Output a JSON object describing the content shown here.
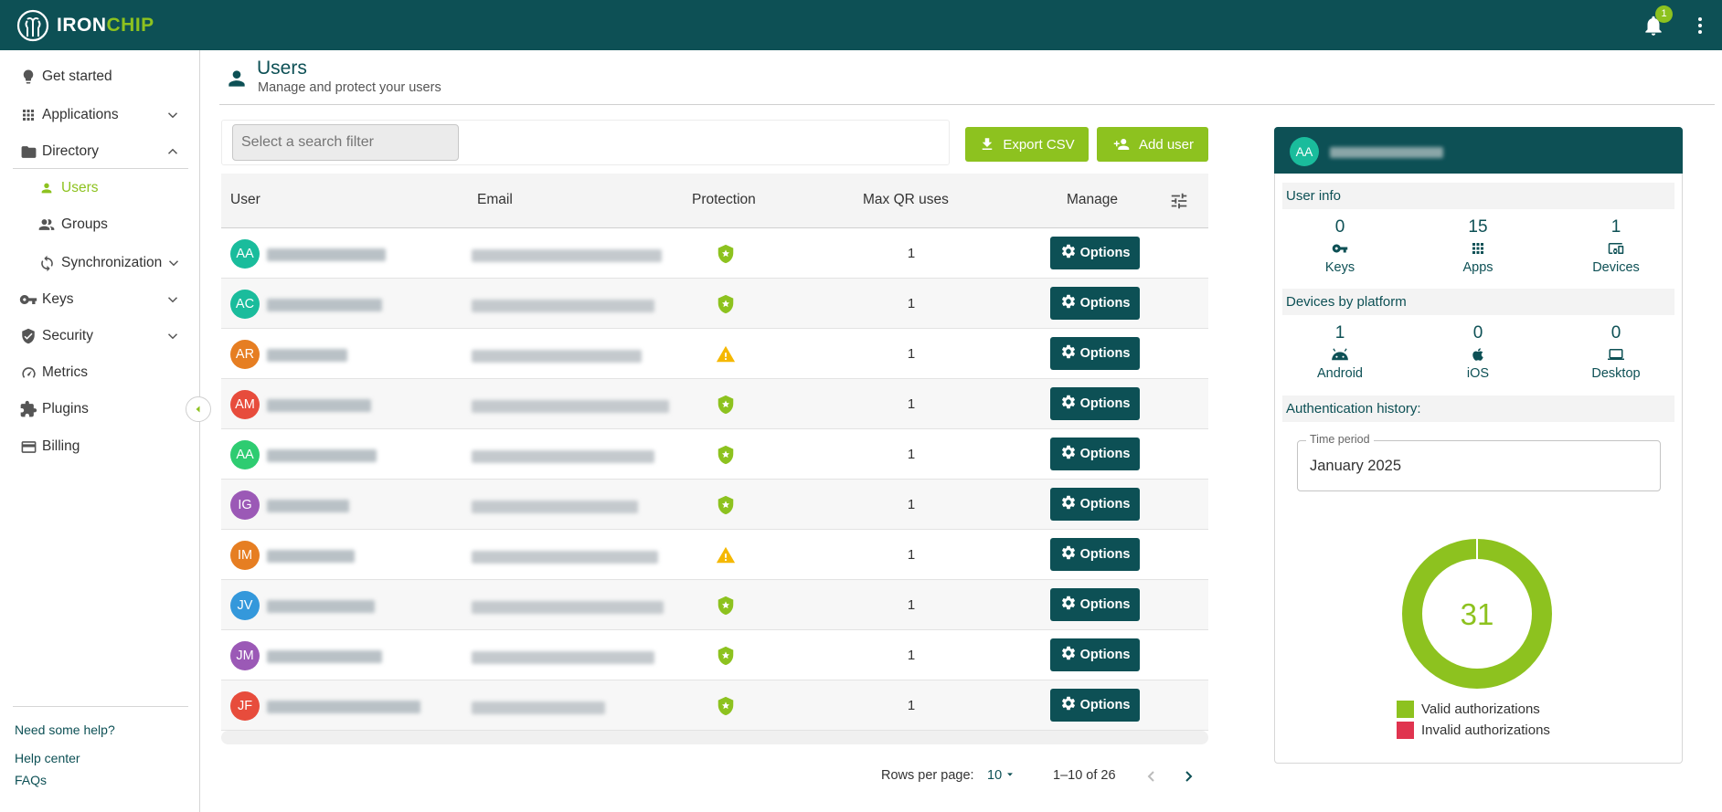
{
  "app": {
    "logo_iron": "IRON",
    "logo_chip": "CHIP",
    "notification_count": "1"
  },
  "sidebar": {
    "items": [
      {
        "label": "Get started",
        "icon": "bulb-icon"
      },
      {
        "label": "Applications",
        "icon": "apps-grid-icon"
      },
      {
        "label": "Directory",
        "icon": "folder-icon"
      },
      {
        "label": "Users",
        "icon": "person-icon"
      },
      {
        "label": "Groups",
        "icon": "people-icon"
      },
      {
        "label": "Synchronization",
        "icon": "sync-icon"
      },
      {
        "label": "Keys",
        "icon": "key-icon"
      },
      {
        "label": "Security",
        "icon": "shield-icon"
      },
      {
        "label": "Metrics",
        "icon": "gauge-icon"
      },
      {
        "label": "Plugins",
        "icon": "puzzle-icon"
      },
      {
        "label": "Billing",
        "icon": "card-icon"
      }
    ],
    "help_title": "Need some help?",
    "help_center": "Help center",
    "faqs": "FAQs"
  },
  "header": {
    "title": "Users",
    "subtitle": "Manage and protect your users"
  },
  "toolbar": {
    "search_placeholder": "Select a search filter",
    "export_label": "Export CSV",
    "add_label": "Add user"
  },
  "table": {
    "columns": [
      "User",
      "Email",
      "Protection",
      "Max QR uses",
      "Manage"
    ],
    "option_label": "Options",
    "rows": [
      {
        "initials": "AA",
        "color": "#1abc9c",
        "protection": "protected",
        "qr": "1"
      },
      {
        "initials": "AC",
        "color": "#1abc9c",
        "protection": "protected",
        "qr": "1"
      },
      {
        "initials": "AR",
        "color": "#e67e22",
        "protection": "warning",
        "qr": "1"
      },
      {
        "initials": "AM",
        "color": "#e74c3c",
        "protection": "protected",
        "qr": "1"
      },
      {
        "initials": "AA",
        "color": "#2ecc71",
        "protection": "protected",
        "qr": "1"
      },
      {
        "initials": "IG",
        "color": "#9b59b6",
        "protection": "protected",
        "qr": "1"
      },
      {
        "initials": "IM",
        "color": "#e67e22",
        "protection": "warning",
        "qr": "1"
      },
      {
        "initials": "JV",
        "color": "#3498db",
        "protection": "protected",
        "qr": "1"
      },
      {
        "initials": "JM",
        "color": "#9b59b6",
        "protection": "protected",
        "qr": "1"
      },
      {
        "initials": "JF",
        "color": "#e74c3c",
        "protection": "protected",
        "qr": "1"
      }
    ]
  },
  "pagination": {
    "rows_per_page_label": "Rows per page:",
    "rows_per_page": "10",
    "range": "1–10 of 26"
  },
  "panel": {
    "avatar_initials": "AA",
    "user_info_title": "User info",
    "user_info": [
      {
        "value": "0",
        "label": "Keys",
        "icon": "key-icon"
      },
      {
        "value": "15",
        "label": "Apps",
        "icon": "apps-grid-icon"
      },
      {
        "value": "1",
        "label": "Devices",
        "icon": "devices-icon"
      }
    ],
    "platform_title": "Devices by platform",
    "platforms": [
      {
        "value": "1",
        "label": "Android",
        "icon": "android-icon"
      },
      {
        "value": "0",
        "label": "iOS",
        "icon": "apple-icon"
      },
      {
        "value": "0",
        "label": "Desktop",
        "icon": "laptop-icon"
      }
    ],
    "auth_title": "Authentication history:",
    "time_period_label": "Time period",
    "time_period_value": "January 2025",
    "total": "31",
    "valid_count": 31,
    "invalid_count": 0,
    "legend_valid": "Valid authorizations",
    "legend_invalid": "Invalid authorizations",
    "colors": {
      "brand": "#0d5055",
      "accent": "#8dc21f",
      "invalid": "#e0344f"
    }
  }
}
